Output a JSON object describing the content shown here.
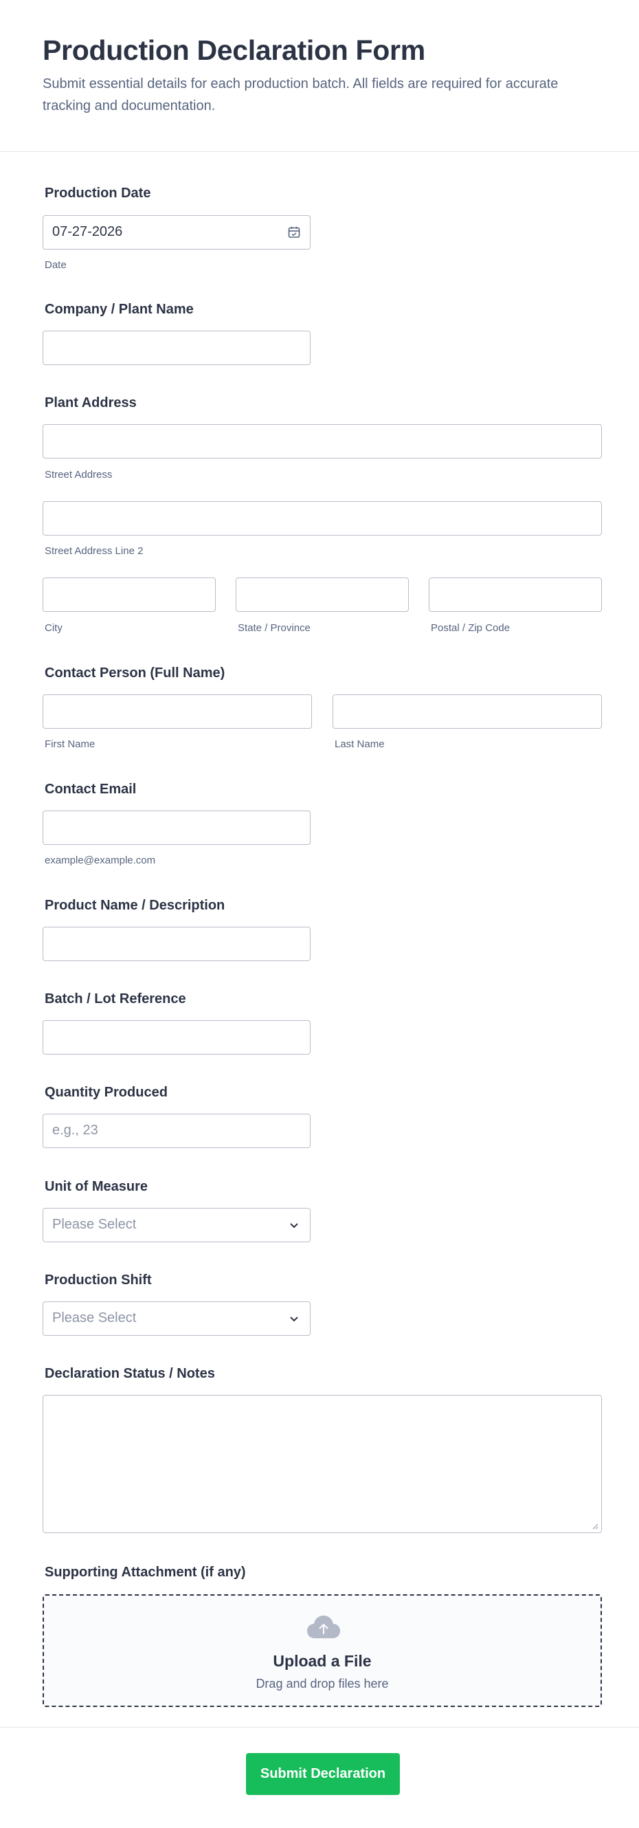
{
  "header": {
    "title": "Production Declaration Form",
    "subtitle": "Submit essential details for each production batch. All fields are required for accurate tracking and documentation."
  },
  "production_date": {
    "label": "Production Date",
    "value": "07-27-2026",
    "sublabel": "Date",
    "icon": "calendar-icon"
  },
  "company": {
    "label": "Company / Plant Name",
    "value": ""
  },
  "address": {
    "label": "Plant Address",
    "street_sublabel": "Street Address",
    "street2_sublabel": "Street Address Line 2",
    "city_sublabel": "City",
    "state_sublabel": "State / Province",
    "zip_sublabel": "Postal / Zip Code"
  },
  "contact_person": {
    "label": "Contact Person (Full Name)",
    "first_sublabel": "First Name",
    "last_sublabel": "Last Name"
  },
  "contact_email": {
    "label": "Contact Email",
    "sublabel": "example@example.com"
  },
  "product": {
    "label": "Product Name / Description"
  },
  "batch": {
    "label": "Batch / Lot Reference"
  },
  "quantity": {
    "label": "Quantity Produced",
    "placeholder": "e.g., 23"
  },
  "unit": {
    "label": "Unit of Measure",
    "selected": "Please Select",
    "icon": "chevron-down-icon"
  },
  "shift": {
    "label": "Production Shift",
    "selected": "Please Select",
    "icon": "chevron-down-icon"
  },
  "notes": {
    "label": "Declaration Status / Notes"
  },
  "attachment": {
    "label": "Supporting Attachment (if any)",
    "title": "Upload a File",
    "subtitle": "Drag and drop files here",
    "icon": "cloud-upload-icon"
  },
  "submit": {
    "label": "Submit Declaration"
  },
  "colors": {
    "accent": "#18bd5b",
    "text": "#2c3345",
    "muted": "#57647e",
    "border": "#b8bdc9"
  }
}
